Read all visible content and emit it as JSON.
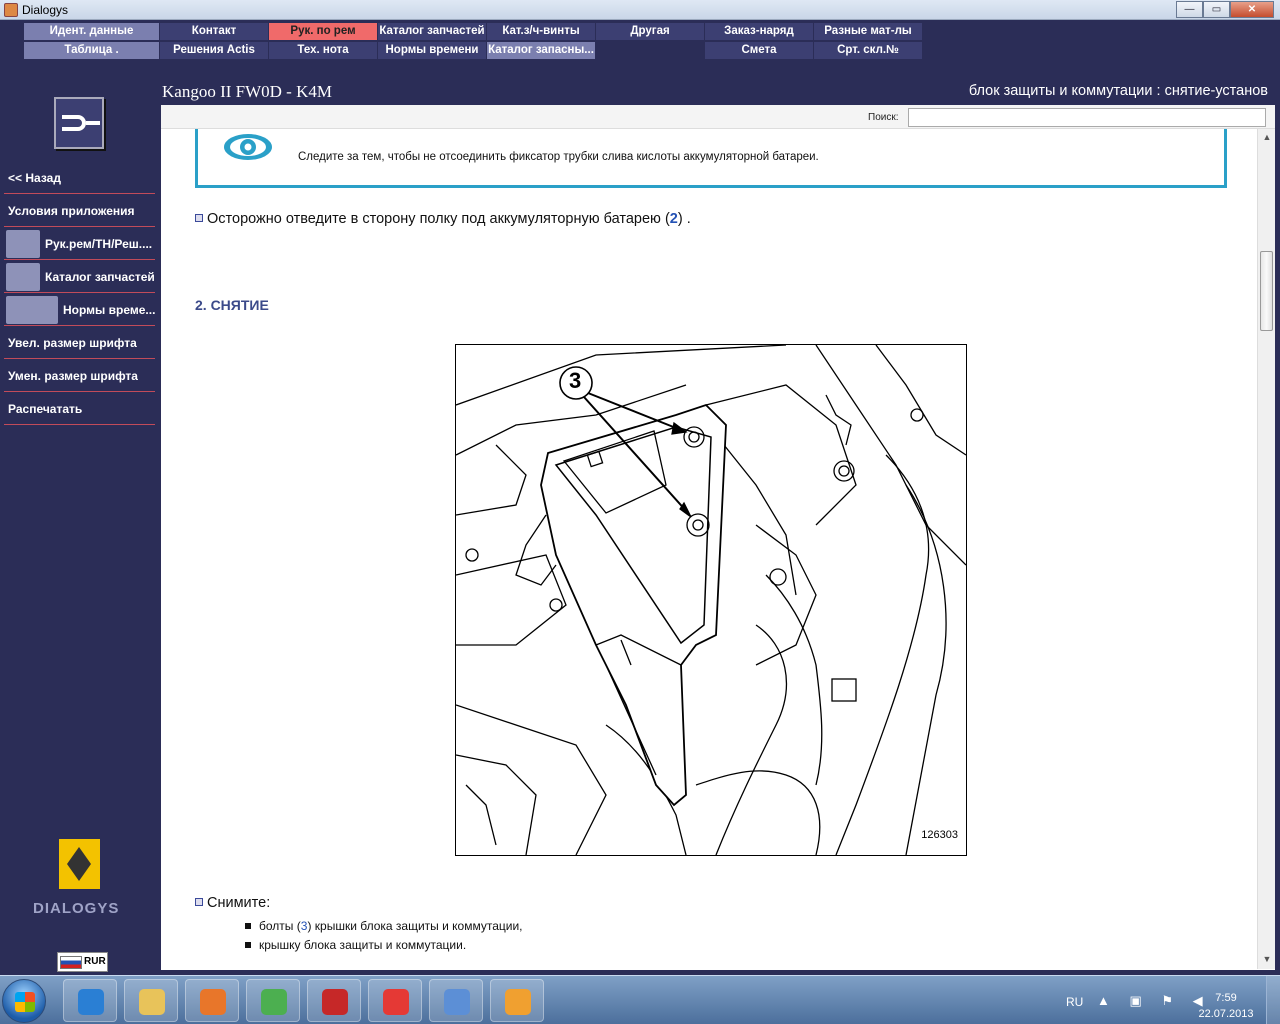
{
  "window": {
    "title": "Dialogys",
    "controls": {
      "minimize": "—",
      "maximize": "▭",
      "close": "✕"
    }
  },
  "menu": {
    "row1": [
      {
        "label": "Идент. данные",
        "state": "dim"
      },
      {
        "label": "Контакт",
        "state": "dark"
      },
      {
        "label": "Рук. по рем",
        "state": "active"
      },
      {
        "label": "Каталог запчастей",
        "state": "dark"
      },
      {
        "label": "Кат.з/ч-винты",
        "state": "dark"
      },
      {
        "label": "Другая",
        "state": "dark"
      },
      {
        "label": "Заказ-наряд",
        "state": "dark"
      },
      {
        "label": "Разные мат-лы",
        "state": "dark"
      }
    ],
    "row2": [
      {
        "label": "Таблица .",
        "state": "dim"
      },
      {
        "label": "Решения Actis",
        "state": "dark"
      },
      {
        "label": "Тех. нота",
        "state": "dark"
      },
      {
        "label": "Нормы времени",
        "state": "dark"
      },
      {
        "label": "Каталог запасны...",
        "state": "dim"
      },
      {
        "label": "",
        "state": "empty"
      },
      {
        "label": "Смета",
        "state": "dark"
      },
      {
        "label": "Срт. скл.№",
        "state": "dark"
      }
    ]
  },
  "header": {
    "vehicle": "Kangoo II FW0D - K4M",
    "doc_title": "блок защиты и коммутации : снятие-установ"
  },
  "sidebar": {
    "items": [
      {
        "label": "<< Назад"
      },
      {
        "label": "Условия приложения"
      },
      {
        "label": "Рук.рем/ТН/Реш....",
        "icon": "wrench-icon"
      },
      {
        "label": "Каталог запчастей",
        "icon": "parts-icon"
      },
      {
        "label": "Нормы време...",
        "icon": "clock-icon"
      },
      {
        "label": "Увел. размер шрифта"
      },
      {
        "label": "Умен. размер шрифта"
      },
      {
        "label": "Распечатать"
      }
    ],
    "brand": "DIALOGYS",
    "currency": "RUR"
  },
  "search": {
    "label": "Поиск:",
    "value": ""
  },
  "document": {
    "note_text": "Следите за тем, чтобы не отсоединить фиксатор трубки слива кислоты аккумуляторной батареи.",
    "para1_before": "Осторожно отведите в сторону полку под аккумуляторную батарею (",
    "para1_ref": "2",
    "para1_after": ") .",
    "section_heading": "2. СНЯТИЕ",
    "figure_callout": "3",
    "figure_number": "126303",
    "para2": "Снимите:",
    "list": [
      {
        "before": "болты (",
        "ref": "3",
        "after": ") крышки блока защиты и коммутации,"
      },
      {
        "before": "крышку блока защиты и коммутации.",
        "ref": "",
        "after": ""
      }
    ]
  },
  "taskbar": {
    "apps": [
      {
        "name": "ie-icon",
        "color": "#2a7fd4"
      },
      {
        "name": "explorer-icon",
        "color": "#e8c35a"
      },
      {
        "name": "media-player-icon",
        "color": "#e8762a"
      },
      {
        "name": "chrome-icon",
        "color": "#4caf50"
      },
      {
        "name": "kaspersky-icon",
        "color": "#c62828"
      },
      {
        "name": "yandex-icon",
        "color": "#e53935"
      },
      {
        "name": "speaker-icon",
        "color": "#5c8fd6"
      },
      {
        "name": "java-icon",
        "color": "#f0a030"
      }
    ],
    "lang": "RU",
    "time": "7:59",
    "date": "22.07.2013"
  }
}
